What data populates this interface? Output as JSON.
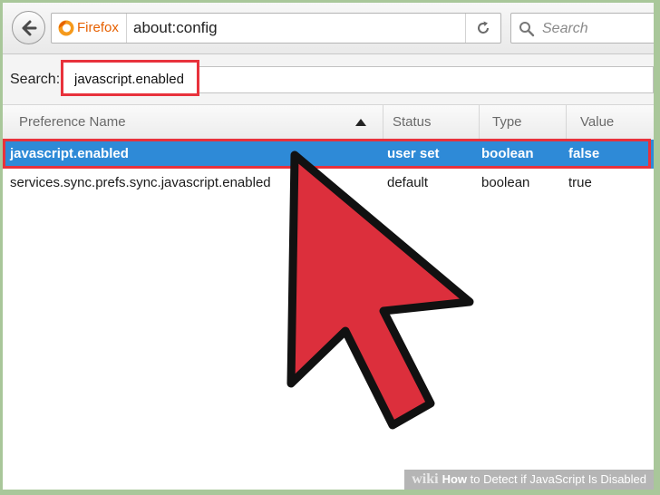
{
  "browser": {
    "brand_label": "Firefox",
    "url": "about:config",
    "search_placeholder": "Search"
  },
  "config": {
    "filter_label": "Search:",
    "filter_value": "javascript.enabled",
    "columns": {
      "name": "Preference Name",
      "status": "Status",
      "type": "Type",
      "value": "Value"
    },
    "rows": [
      {
        "name": "javascript.enabled",
        "status": "user set",
        "type": "boolean",
        "value": "false",
        "selected": true
      },
      {
        "name": "services.sync.prefs.sync.javascript.enabled",
        "status": "default",
        "type": "boolean",
        "value": "true",
        "selected": false
      }
    ]
  },
  "annotations": {
    "highlight_color": "#e8323c",
    "selection_color": "#2e8ad7"
  },
  "watermark": {
    "logo": "wiki",
    "how": "How",
    "title": "to Detect if JavaScript Is Disabled"
  }
}
